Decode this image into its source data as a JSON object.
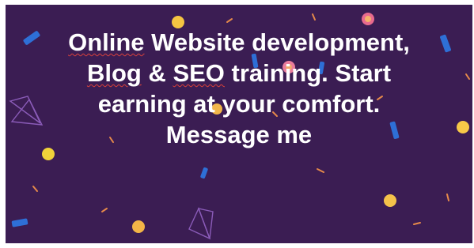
{
  "headline": {
    "line1_a": "Online",
    "line1_b": " Website development,",
    "line2_a": "Blog",
    "line2_b": " & ",
    "line2_c": "SEO",
    "line2_d": " training. Start",
    "line3": "earning at your comfort.",
    "line4": "Message me"
  },
  "colors": {
    "background": "#3b1d53",
    "text": "#ffffff",
    "spellcheck_underline": "#d9413b"
  }
}
